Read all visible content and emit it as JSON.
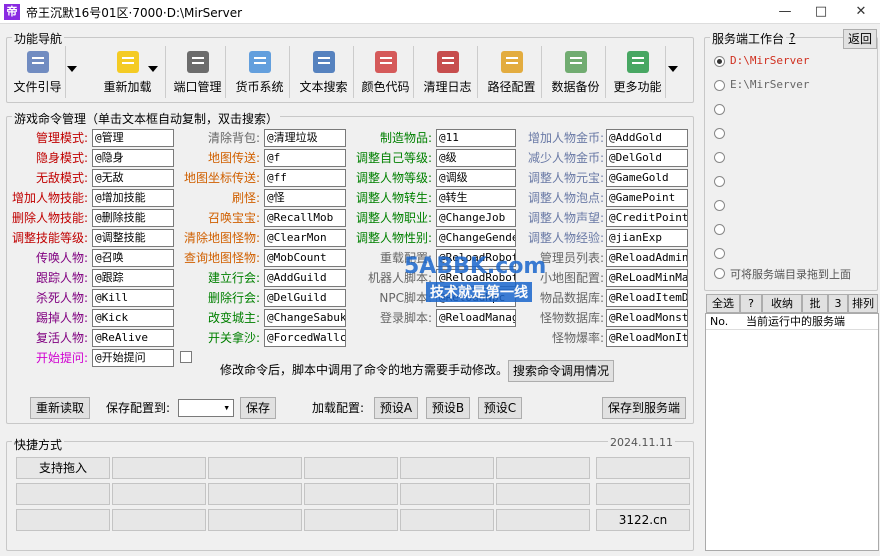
{
  "window": {
    "title": "帝王沉默16号01区·7000·D:\\MirServer",
    "icon_glyph": "帝",
    "min": "—",
    "max": "□",
    "close": "✕"
  },
  "toolbar": {
    "title": "功能导航",
    "buttons": [
      "文件引导",
      "重新加载",
      "端口管理",
      "货币系统",
      "文本搜索",
      "颜色代码",
      "清理日志",
      "路径配置",
      "数据备份",
      "更多功能"
    ]
  },
  "commands": {
    "title": "游戏命令管理（单击文本框自动复制，双击搜索）",
    "col1": [
      [
        "管理模式:",
        "@管理"
      ],
      [
        "隐身模式:",
        "@隐身"
      ],
      [
        "无敌模式:",
        "@无敌"
      ],
      [
        "增加人物技能:",
        "@增加技能"
      ],
      [
        "删除人物技能:",
        "@删除技能"
      ],
      [
        "调整技能等级:",
        "@调整技能"
      ],
      [
        "传唤人物:",
        "@召唤"
      ],
      [
        "跟踪人物:",
        "@跟踪"
      ],
      [
        "杀死人物:",
        "@Kill"
      ],
      [
        "踢掉人物:",
        "@Kick"
      ],
      [
        "复活人物:",
        "@ReAlive"
      ],
      [
        "开始提问:",
        "@开始提问"
      ]
    ],
    "col2": [
      [
        "清除背包:",
        "@清理垃圾"
      ],
      [
        "地图传送:",
        "@f"
      ],
      [
        "地图坐标传送:",
        "@ff"
      ],
      [
        "刷怪:",
        "@怪"
      ],
      [
        "召唤宝宝:",
        "@RecallMob"
      ],
      [
        "清除地图怪物:",
        "@ClearMon"
      ],
      [
        "查询地图怪物:",
        "@MobCount"
      ],
      [
        "建立行会:",
        "@AddGuild"
      ],
      [
        "删除行会:",
        "@DelGuild"
      ],
      [
        "改变城主:",
        "@ChangeSabukL"
      ],
      [
        "开关拿沙:",
        "@ForcedWallco"
      ]
    ],
    "col3": [
      [
        "制造物品:",
        "@11"
      ],
      [
        "调整自己等级:",
        "@级"
      ],
      [
        "调整人物等级:",
        "@调级"
      ],
      [
        "调整人物转生:",
        "@转生"
      ],
      [
        "调整人物职业:",
        "@ChangeJob"
      ],
      [
        "调整人物性别:",
        "@ChangeGender"
      ],
      [
        "重载配置:",
        "@ReloadRobot"
      ],
      [
        "机器人脚本:",
        "@ReloadRobotM"
      ],
      [
        "NPC脚本:",
        "@ReloadNpc"
      ],
      [
        "登录脚本:",
        "@ReloadManage"
      ]
    ],
    "col4": [
      [
        "增加人物金币:",
        "@AddGold"
      ],
      [
        "减少人物金币:",
        "@DelGold"
      ],
      [
        "调整人物元宝:",
        "@GameGold"
      ],
      [
        "调整人物泡点:",
        "@GamePoint"
      ],
      [
        "调整人物声望:",
        "@CreditPoint"
      ],
      [
        "调整人物经验:",
        "@jianExp"
      ],
      [
        "管理员列表:",
        "@ReloadAdmin"
      ],
      [
        "小地图配置:",
        "@ReLoadMinMap"
      ],
      [
        "物品数据库:",
        "@ReloadItemDB"
      ],
      [
        "怪物数据库:",
        "@ReloadMonste"
      ],
      [
        "怪物爆率:",
        "@ReloadMonIte"
      ]
    ],
    "note": "修改命令后，脚本中调用了命令的地方需要手动修改。",
    "search_btn": "搜索命令调用情况",
    "reload_btn": "重新读取",
    "save_to_label": "保存配置到:",
    "save_btn": "保存",
    "load_label": "加载配置:",
    "preset_a": "预设A",
    "preset_b": "预设B",
    "preset_c": "预设C",
    "save_server_btn": "保存到服务端"
  },
  "shortcuts": {
    "title": "快捷方式",
    "date": "2024.11.11",
    "first": "支持拖入",
    "last": "3122.cn"
  },
  "server": {
    "title": "服务端工作台",
    "help": "?",
    "back": "返回",
    "entries": [
      "D:\\MirServer",
      "E:\\MirServer",
      "",
      "",
      "",
      "",
      "",
      "",
      ""
    ],
    "hint": "可将服务端目录拖到上面",
    "tabs": [
      "全选",
      "?",
      "收纳",
      "批",
      "3",
      "排列"
    ],
    "col_no": "No.",
    "col_name": "当前运行中的服务端"
  },
  "watermark": {
    "site": "5ABBK.com",
    "slogan": "技术就是第一线"
  },
  "colors": {
    "red": "#c00000",
    "orange": "#d06000",
    "green": "#008000",
    "purple": "#800080",
    "magenta": "#d000d0",
    "gray": "#666666",
    "slate": "#6a7aa6",
    "blue": "#1060c0"
  }
}
